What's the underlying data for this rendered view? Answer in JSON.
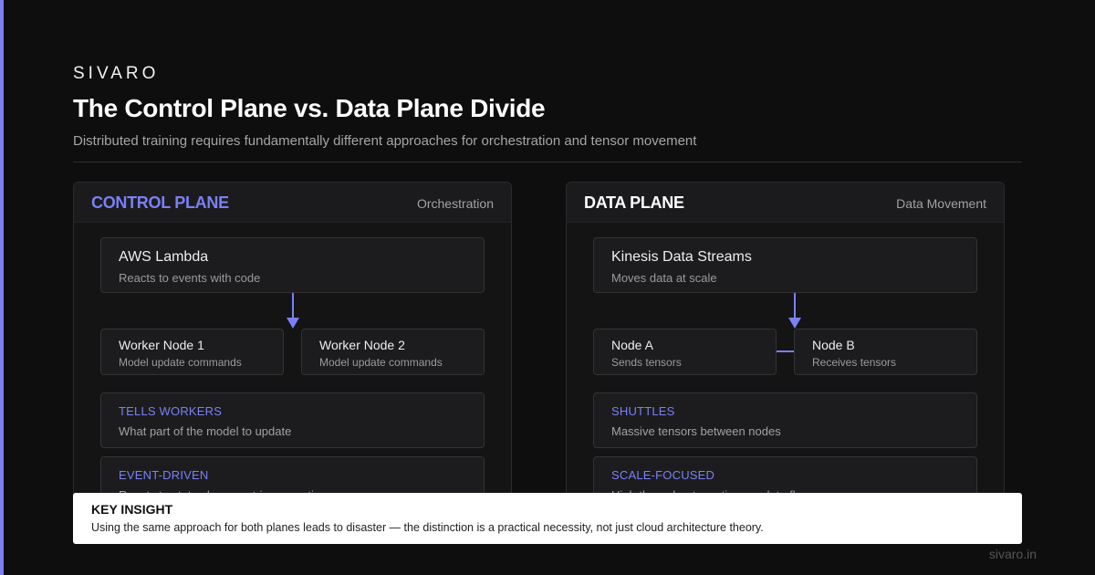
{
  "brand": "SIVARO",
  "title": "The Control Plane vs. Data Plane Divide",
  "subtitle": "Distributed training requires fundamentally different approaches for orchestration and tensor movement",
  "colors": {
    "accent": "#7b80f5",
    "background": "#0e0e0e",
    "insight_bg": "#ffffff"
  },
  "control_plane": {
    "title": "CONTROL PLANE",
    "tag": "Orchestration",
    "top": {
      "title": "AWS Lambda",
      "sub": "Reacts to events with code"
    },
    "nodes": [
      {
        "title": "Worker Node 1",
        "sub": "Model update commands"
      },
      {
        "title": "Worker Node 2",
        "sub": "Model update commands"
      }
    ],
    "info": [
      {
        "label": "TELLS WORKERS",
        "text": "What part of the model to update"
      },
      {
        "label": "EVENT-DRIVEN",
        "text": "Reacts to state changes, triggers actions"
      }
    ]
  },
  "data_plane": {
    "title": "DATA PLANE",
    "tag": "Data Movement",
    "top": {
      "title": "Kinesis Data Streams",
      "sub": "Moves data at scale"
    },
    "nodes": [
      {
        "title": "Node A",
        "sub": "Sends tensors"
      },
      {
        "title": "Node B",
        "sub": "Receives tensors"
      }
    ],
    "info": [
      {
        "label": "SHUTTLES",
        "text": "Massive tensors between nodes"
      },
      {
        "label": "SCALE-FOCUSED",
        "text": "High throughput, continuous data flow"
      }
    ]
  },
  "insight": {
    "label": "KEY INSIGHT",
    "text": "Using the same approach for both planes leads to disaster — the distinction is a practical necessity, not just cloud architecture theory."
  },
  "footer": "sivaro.in"
}
